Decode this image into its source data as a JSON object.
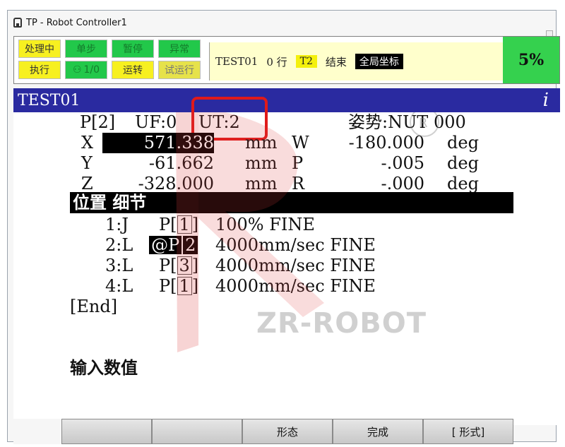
{
  "window": {
    "title": "TP - Robot Controller1"
  },
  "status": {
    "leds_top": [
      "处理中",
      "单步",
      "暂停",
      "异常"
    ],
    "leds_bottom": [
      "执行",
      "1/0",
      "运转",
      "试运行"
    ],
    "message": {
      "program": "TEST01",
      "line": "0 行",
      "mode": "T2",
      "state": "结束",
      "coord": "全局坐标"
    },
    "override": "5%"
  },
  "program_bar": {
    "name": "TEST01",
    "info_icon": "i"
  },
  "position": {
    "header": {
      "point": "P[2]",
      "uf": "UF:0",
      "ut": "UT:2",
      "config": "姿势:NUT 000"
    },
    "rows": [
      {
        "axis": "X",
        "value": "571.338",
        "unit": "mm",
        "raxis": "W",
        "rvalue": "-180.000",
        "runit": "deg"
      },
      {
        "axis": "Y",
        "value": "-61.662",
        "unit": "mm",
        "raxis": "P",
        "rvalue": "-.005",
        "runit": "deg"
      },
      {
        "axis": "Z",
        "value": "-328.000",
        "unit": "mm",
        "raxis": "R",
        "rvalue": "-.000",
        "runit": "deg"
      }
    ]
  },
  "section": {
    "title": "位置 细节"
  },
  "program_lines": [
    {
      "num": "1:J",
      "prefix": "P[",
      "idx": "1",
      "suffix": "]",
      "motion": "100% FINE"
    },
    {
      "num": "2:L",
      "prefix": "@P",
      "idx": "2",
      "suffix": "",
      "motion": "4000mm/sec FINE"
    },
    {
      "num": "3:L",
      "prefix": "P[",
      "idx": "3",
      "suffix": "]",
      "motion": "4000mm/sec FINE"
    },
    {
      "num": "4:L",
      "prefix": "P[",
      "idx": "1",
      "suffix": "]",
      "motion": "4000mm/sec FINE"
    }
  ],
  "end_marker": "[End]",
  "prompt": "输入数值",
  "watermark": "ZR-ROBOT",
  "fkeys": [
    "",
    "",
    "形态",
    "完成",
    "[ 形式]"
  ],
  "colors": {
    "program_bar": "#2a2aa0",
    "override_bg": "#35d14e",
    "highlight": "#e01a1a"
  }
}
